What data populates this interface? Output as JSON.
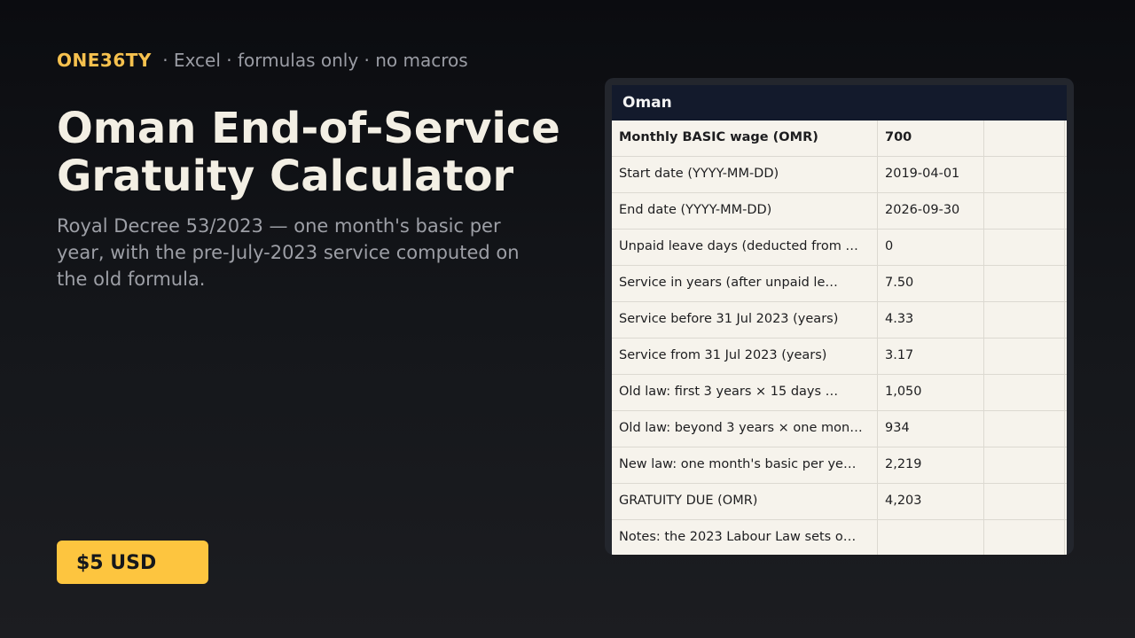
{
  "brand": {
    "name": "ONE36TY",
    "tagline": "· Excel · formulas only · no macros"
  },
  "hero": {
    "title_line1": "Oman End-of-Service",
    "title_line2": "Gratuity Calculator",
    "subtitle": "Royal Decree 53/2023 — one month's basic per year, with the pre-July-2023 service computed on the old formula."
  },
  "price": {
    "label": "$5 USD"
  },
  "colors": {
    "accent": "#f6c14e",
    "price_button": "#fdc53f",
    "sheet_header": "#131a2c",
    "sheet_cell": "#f6f3ec"
  },
  "sheet": {
    "tab": "Oman",
    "rows": [
      {
        "label": "Monthly BASIC wage (OMR)",
        "value": "700",
        "extra": ""
      },
      {
        "label": "Start date (YYYY-MM-DD)",
        "value": "2019-04-01",
        "extra": ""
      },
      {
        "label": "End date (YYYY-MM-DD)",
        "value": "2026-09-30",
        "extra": ""
      },
      {
        "label": "Unpaid leave days (deducted from …",
        "value": "0",
        "extra": ""
      },
      {
        "label": "Service in years (after unpaid le…",
        "value": "7.50",
        "extra": ""
      },
      {
        "label": "Service before 31 Jul 2023 (years)",
        "value": "4.33",
        "extra": ""
      },
      {
        "label": "Service from 31 Jul 2023 (years)",
        "value": "3.17",
        "extra": ""
      },
      {
        "label": "Old law: first 3 years × 15 days …",
        "value": "1,050",
        "extra": ""
      },
      {
        "label": "Old law: beyond 3 years × one mon…",
        "value": "934",
        "extra": ""
      },
      {
        "label": "New law: one month's basic per ye…",
        "value": "2,219",
        "extra": ""
      },
      {
        "label": "GRATUITY DUE (OMR)",
        "value": "4,203",
        "extra": ""
      },
      {
        "label": "Notes: the 2023 Labour Law sets o…",
        "value": "",
        "extra": ""
      }
    ]
  }
}
